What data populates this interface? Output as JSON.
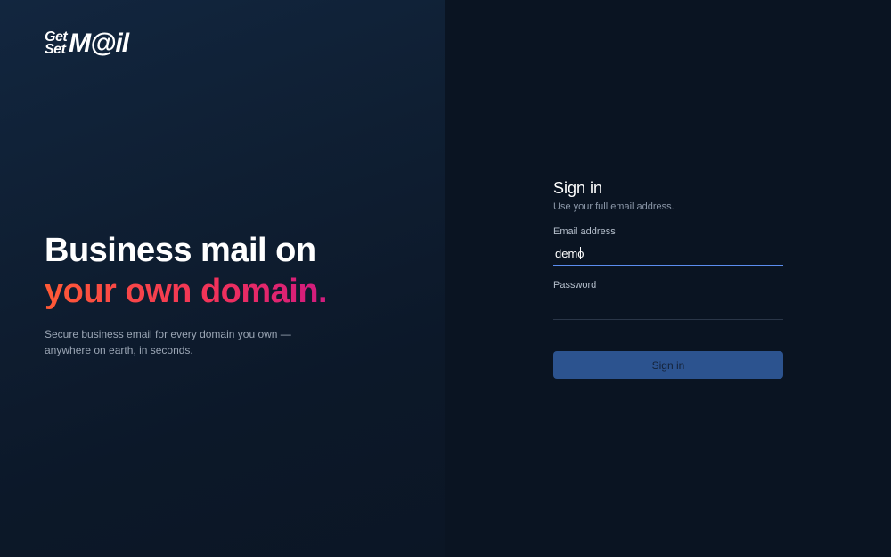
{
  "brand": {
    "logo_line1": "Get",
    "logo_line2": "Set",
    "logo_big": "M@il"
  },
  "hero": {
    "headline_line1": "Business mail on",
    "headline_line2": "your own domain.",
    "subtitle": "Secure business email for every domain you own — anywhere on earth, in seconds."
  },
  "signin": {
    "title": "Sign in",
    "subtitle": "Use your full email address.",
    "email_label": "Email address",
    "email_value": "demo",
    "password_label": "Password",
    "password_value": "",
    "button_label": "Sign in"
  },
  "colors": {
    "accent": "#5b8def",
    "button_bg": "#2c538f",
    "gradient_start": "#ff5a36",
    "gradient_end": "#b4198f"
  }
}
